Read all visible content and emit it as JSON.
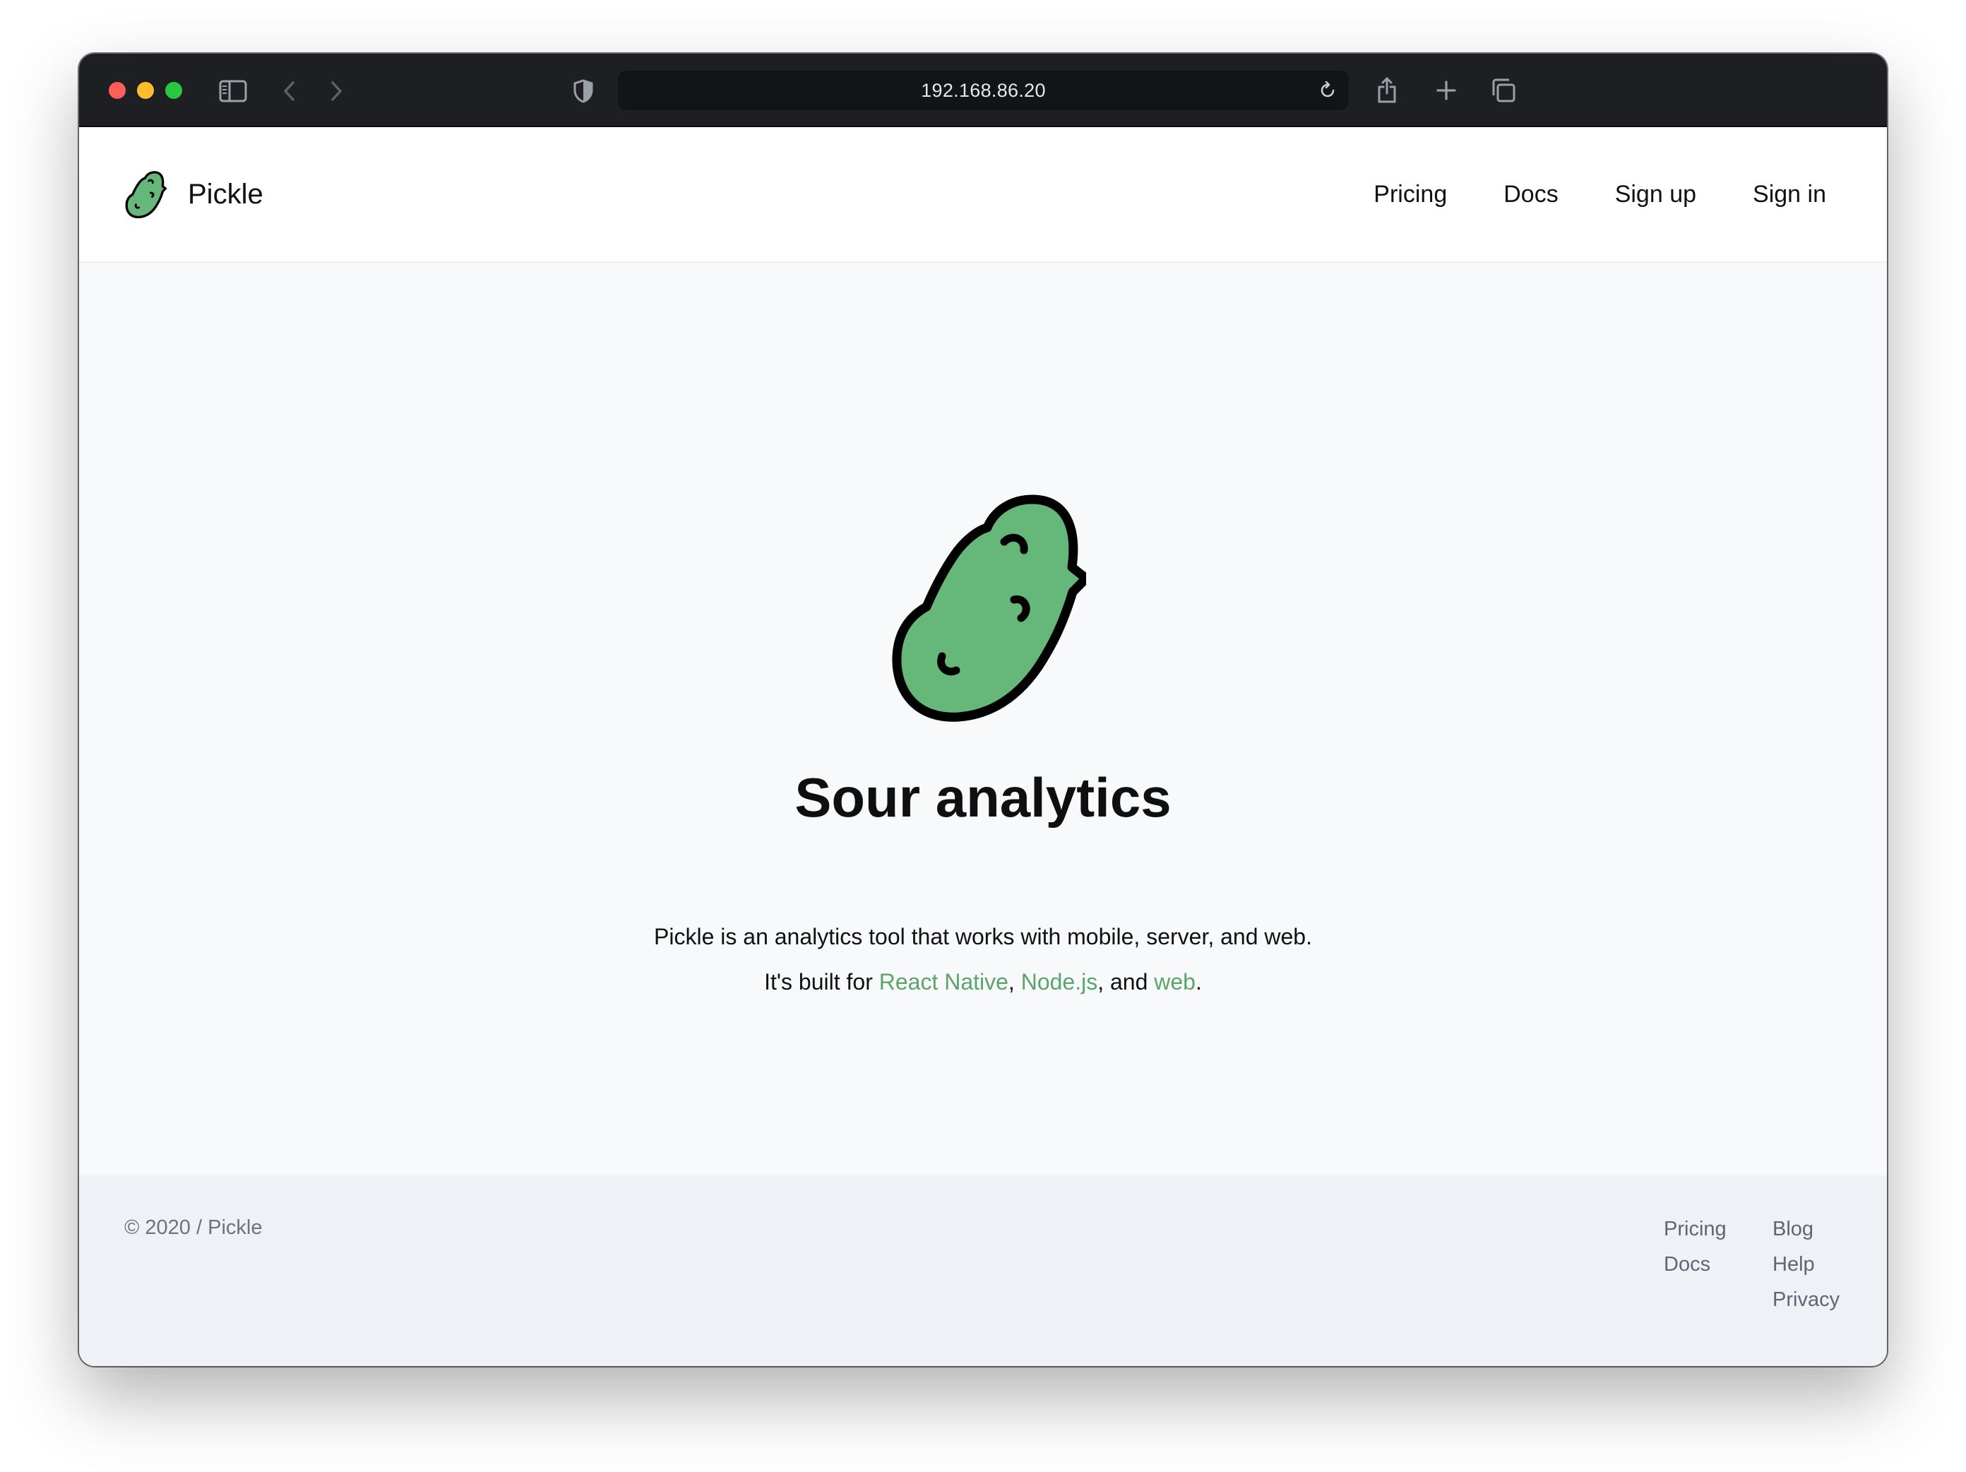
{
  "browser": {
    "url": "192.168.86.20",
    "traffic_colors": {
      "close": "#ff5f57",
      "minimize": "#febc2e",
      "zoom": "#28c840"
    }
  },
  "header": {
    "brand": "Pickle",
    "nav": [
      "Pricing",
      "Docs",
      "Sign up",
      "Sign in"
    ]
  },
  "hero": {
    "title": "Sour analytics",
    "line1": "Pickle is an analytics tool that works with mobile, server, and web.",
    "line2_prefix": "It's built for ",
    "link_react": "React Native",
    "sep1": ", ",
    "link_node": "Node.js",
    "sep2": ", and ",
    "link_web": "web",
    "line2_suffix": "."
  },
  "footer": {
    "copyright": "© 2020 / Pickle",
    "col1": [
      "Pricing",
      "Docs"
    ],
    "col2": [
      "Blog",
      "Help",
      "Privacy"
    ]
  },
  "colors": {
    "accent": "#5aa56a",
    "pickle_green": "#66b87a"
  }
}
